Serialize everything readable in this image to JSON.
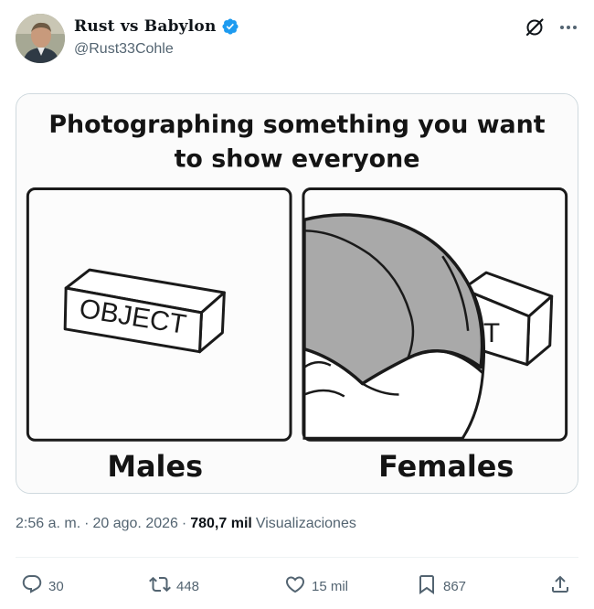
{
  "tweet": {
    "author": {
      "display_name": "Rust vs Babylon",
      "handle": "@Rust33Cohle",
      "verified": true,
      "verified_color": "#1d9bf0"
    },
    "header_icons": [
      "grok-icon",
      "more-icon"
    ],
    "image": {
      "title_line1": "Photographing something you want",
      "title_line2": "to show everyone",
      "panel_left_label": "Males",
      "panel_right_label": "Females",
      "box_left_text": "OBJECT",
      "box_right_text": "T"
    },
    "meta": {
      "time": "2:56 a. m.",
      "separator": "·",
      "date": "20 ago. 2026",
      "views_count": "780,7 mil",
      "views_label": "Visualizaciones"
    },
    "actions": {
      "replies": "30",
      "retweets": "448",
      "likes": "15 mil",
      "bookmarks": "867"
    }
  }
}
